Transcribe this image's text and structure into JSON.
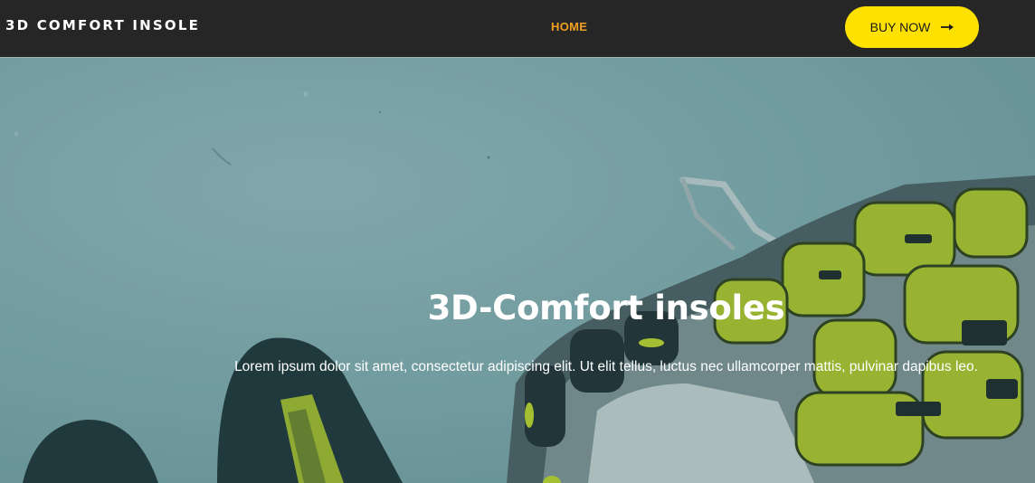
{
  "header": {
    "logo": "3D COMFORT INSOLE",
    "nav": [
      {
        "label": "HOME",
        "active": true
      }
    ],
    "cta_label": "BUY NOW",
    "cta_icon": "arrow-right-icon"
  },
  "hero": {
    "title": "3D-Comfort insoles",
    "text": "Lorem ipsum dolor sit amet, consectetur adipiscing elit. Ut elit tellus, luctus nec ullamcorper mattis, pulvinar dapibus leo."
  },
  "colors": {
    "header_bg": "#262626",
    "nav_active": "#f0a020",
    "cta_bg": "#ffe100",
    "hero_tint": "#7ea6a8",
    "accent_lime": "#b5cc2a"
  }
}
